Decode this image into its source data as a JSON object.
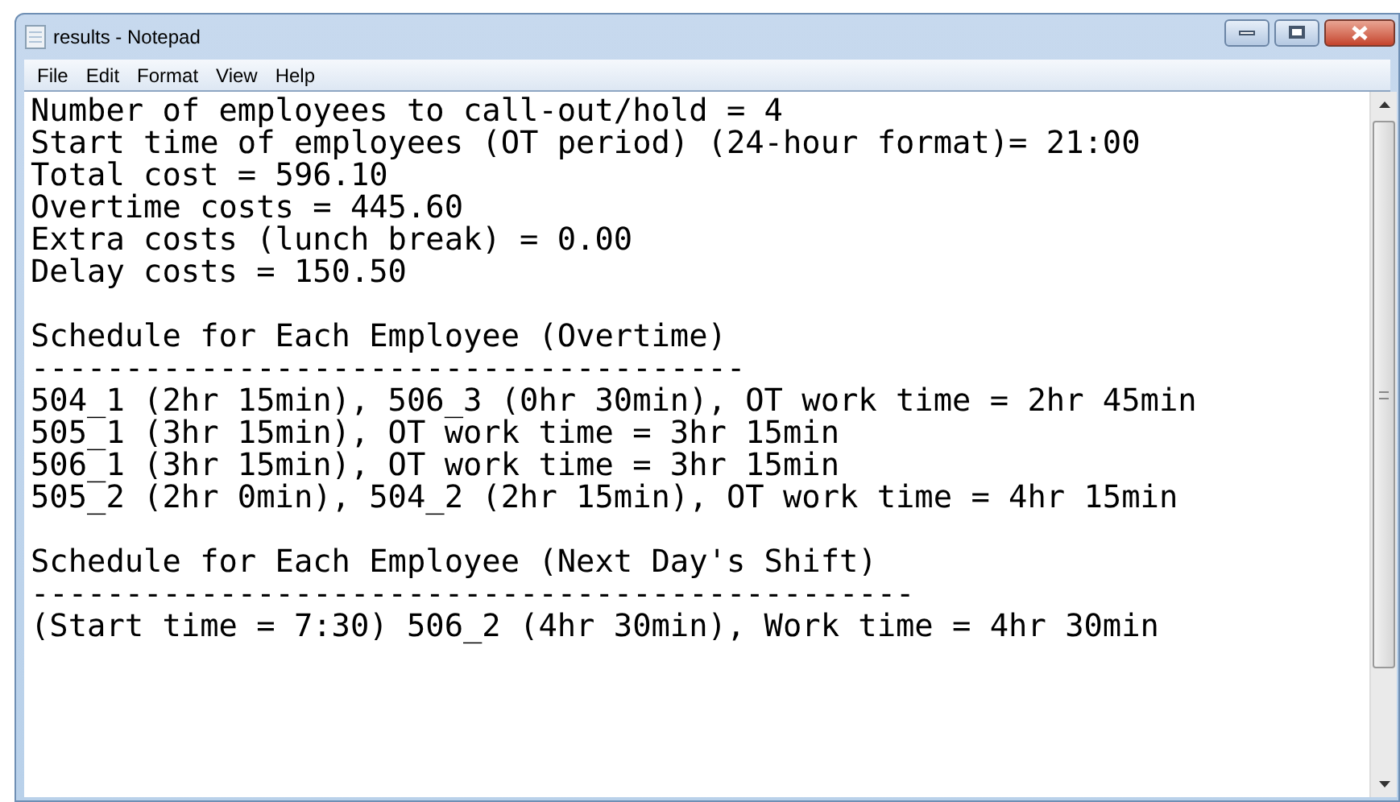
{
  "window": {
    "title": "results - Notepad"
  },
  "menu": [
    "File",
    "Edit",
    "Format",
    "View",
    "Help"
  ],
  "document": {
    "paragraphs": [
      {
        "lines": [
          "Number of employees to call-out/hold = 4",
          "Start time of employees (OT period) (24-hour format)= 21:00",
          "Total cost = 596.10",
          "Overtime costs = 445.60",
          "Extra costs (lunch break) = 0.00",
          "Delay costs = 150.50"
        ]
      },
      {
        "lines": [
          "Schedule for Each Employee (Overtime)",
          "--------------------------------------",
          "504_1 (2hr 15min), 506_3 (0hr 30min), OT work time = 2hr 45min",
          "505_1 (3hr 15min), OT work time = 3hr 15min",
          "506_1 (3hr 15min), OT work time = 3hr 15min",
          "505_2 (2hr 0min), 504_2 (2hr 15min), OT work time = 4hr 15min"
        ]
      },
      {
        "lines": [
          "Schedule for Each Employee (Next Day's Shift)",
          "-----------------------------------------------",
          "(Start time = 7:30) 506_2 (4hr 30min), Work time = 4hr 30min"
        ]
      }
    ]
  }
}
